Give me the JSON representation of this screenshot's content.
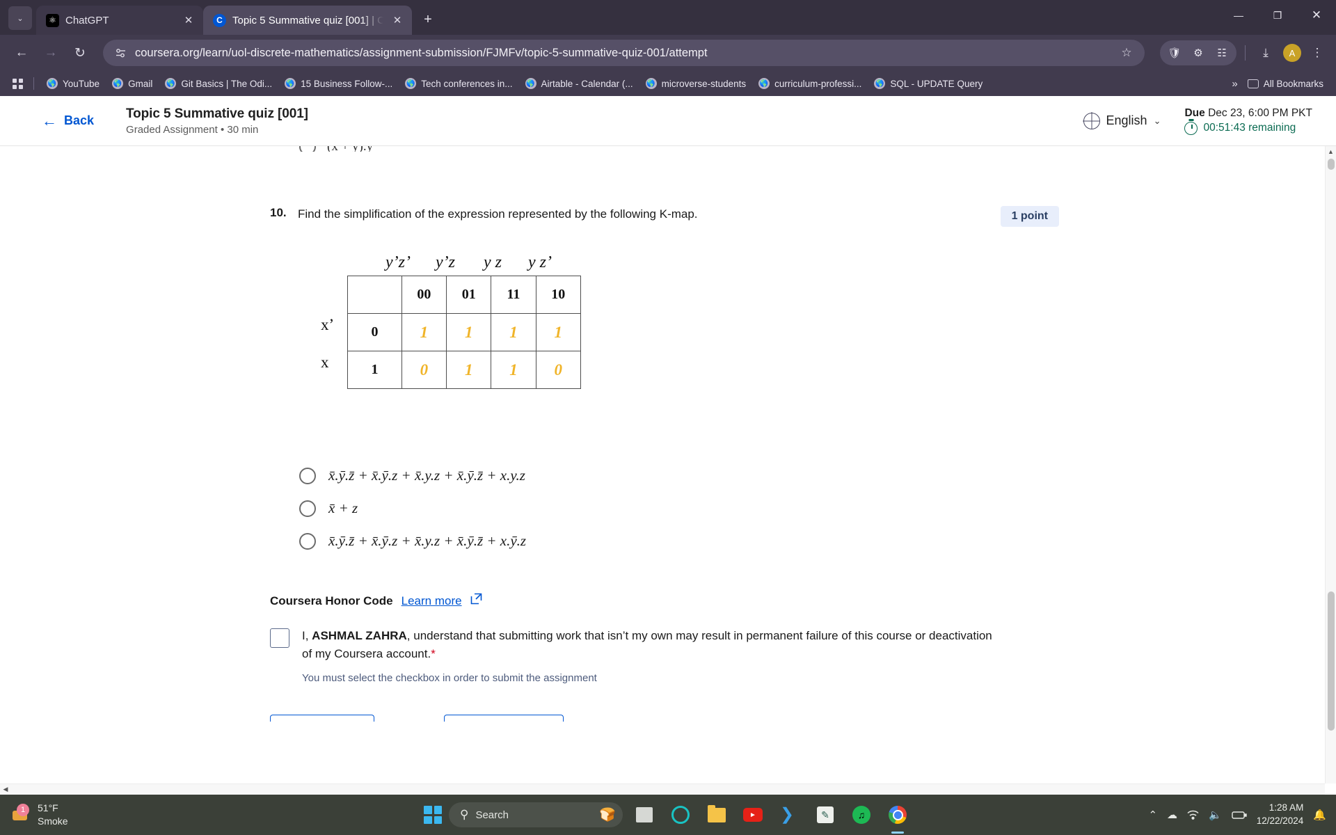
{
  "browser": {
    "tabs": [
      {
        "title": "ChatGPT",
        "favicon": "chatgpt-icon",
        "active": false
      },
      {
        "title": "Topic 5 Summative quiz [001] | C",
        "favicon": "coursera-icon",
        "active": true
      }
    ],
    "new_tab_label": "+",
    "tab_list_chevron": "⌄",
    "window_controls": {
      "minimize": "—",
      "maximize": "❐",
      "close": "✕"
    },
    "nav": {
      "back": "←",
      "forward": "→",
      "reload": "↻"
    },
    "url": "coursera.org/learn/uol-discrete-mathematics/assignment-submission/FJMFv/topic-5-summative-quiz-001/attempt",
    "site_info_icon": "permissions-icon",
    "star_icon": "☆",
    "extensions": [
      "shield-icon",
      "puzzle-icon",
      "split-screen-icon"
    ],
    "download_icon": "⤓",
    "profile_initial": "A",
    "menu_icon": "⋮",
    "bookmarks": [
      "YouTube",
      "Gmail",
      "Git Basics | The Odi...",
      "15 Business Follow-...",
      "Tech conferences in...",
      "Airtable - Calendar (...",
      "microverse-students",
      "curriculum-professi...",
      "SQL - UPDATE Query"
    ],
    "bookmarks_overflow": "»",
    "all_bookmarks_label": "All Bookmarks"
  },
  "quiz_header": {
    "back_label": "Back",
    "back_arrow": "←",
    "title": "Topic 5 Summative quiz [001]",
    "subtitle": "Graded Assignment • 30 min",
    "language": "English",
    "language_chevron": "⌄",
    "due_label": "Due",
    "due_value": "Dec 23, 6:00 PM PKT",
    "time_remaining": "00:51:43 remaining"
  },
  "question": {
    "number": "10.",
    "text": "Find the simplification of the expression represented by the following K-map.",
    "points": "1 point"
  },
  "kmap": {
    "column_headers_top": [
      "y’z’",
      "y’z",
      "y z",
      "y z’"
    ],
    "column_codes": [
      "00",
      "01",
      "11",
      "10"
    ],
    "row_labels": [
      "x’",
      "x"
    ],
    "row_codes": [
      "0",
      "1"
    ],
    "rows": [
      [
        "1",
        "1",
        "1",
        "1"
      ],
      [
        "0",
        "1",
        "1",
        "0"
      ]
    ],
    "value_color": "#f0b429"
  },
  "options": [
    {
      "id": "opt1",
      "selected": false,
      "expr_parts": [
        "x",
        ".",
        "y",
        ".",
        "z",
        " + ",
        "x",
        ".",
        "y",
        ".z + ",
        "x",
        ".y.z + ",
        "x",
        ".",
        "y",
        ".",
        "z",
        " + x.y.z"
      ]
    },
    {
      "id": "opt2",
      "selected": false,
      "expr_parts": [
        "x",
        " + z"
      ]
    },
    {
      "id": "opt3",
      "selected": false,
      "expr_parts": [
        "x",
        ".",
        "y",
        ".",
        "z",
        " + ",
        "x",
        ".",
        "y",
        ".z + ",
        "x",
        ".y.z + ",
        "x",
        ".",
        "y",
        ".",
        "z",
        " + x.",
        "y",
        ".z"
      ]
    }
  ],
  "options_text": {
    "opt1": "x̄.ȳ.z̄ + x̄.ȳ.z + x̄.y.z + x̄.ȳ.z̄ + x.y.z",
    "opt2": "x̄ + z",
    "opt3": "x̄.ȳ.z̄ + x̄.ȳ.z + x̄.y.z + x̄.ȳ.z̄ + x.ȳ.z"
  },
  "partial_option_above": "(x + y).y",
  "honor_code": {
    "title": "Coursera Honor Code",
    "learn_more": "Learn more",
    "external_icon": "↗",
    "statement_prefix": "I, ",
    "user_name": "ASHMAL ZAHRA",
    "statement_rest": ", understand that submitting work that isn’t my own may result in permanent failure of this course or deactivation of my Coursera account.",
    "required_marker": "*",
    "validation_note": "You must select the checkbox in order to submit the assignment",
    "checked": false
  },
  "scrollbars": {
    "v_up_arrow": "▲",
    "v_down_arrow": "▼",
    "h_left_arrow": "◀",
    "h_right_arrow": "▶"
  },
  "taskbar": {
    "weather_temp": "51°F",
    "weather_desc": "Smoke",
    "weather_badge": "1",
    "search_placeholder": "Search",
    "search_icon": "⌕",
    "apps": [
      "task-view-icon",
      "teal-circle-app-icon",
      "file-explorer-icon",
      "youtube-icon",
      "vscode-icon",
      "notes-icon",
      "spotify-icon",
      "chrome-icon"
    ],
    "tray": {
      "chevron_up": "⌃",
      "onedrive_icon": "☁",
      "wifi_icon": "",
      "volume_icon": "🔊",
      "battery_icon": "🔋",
      "notification_icon": "🔔"
    },
    "time": "1:28 AM",
    "date": "12/22/2024"
  }
}
